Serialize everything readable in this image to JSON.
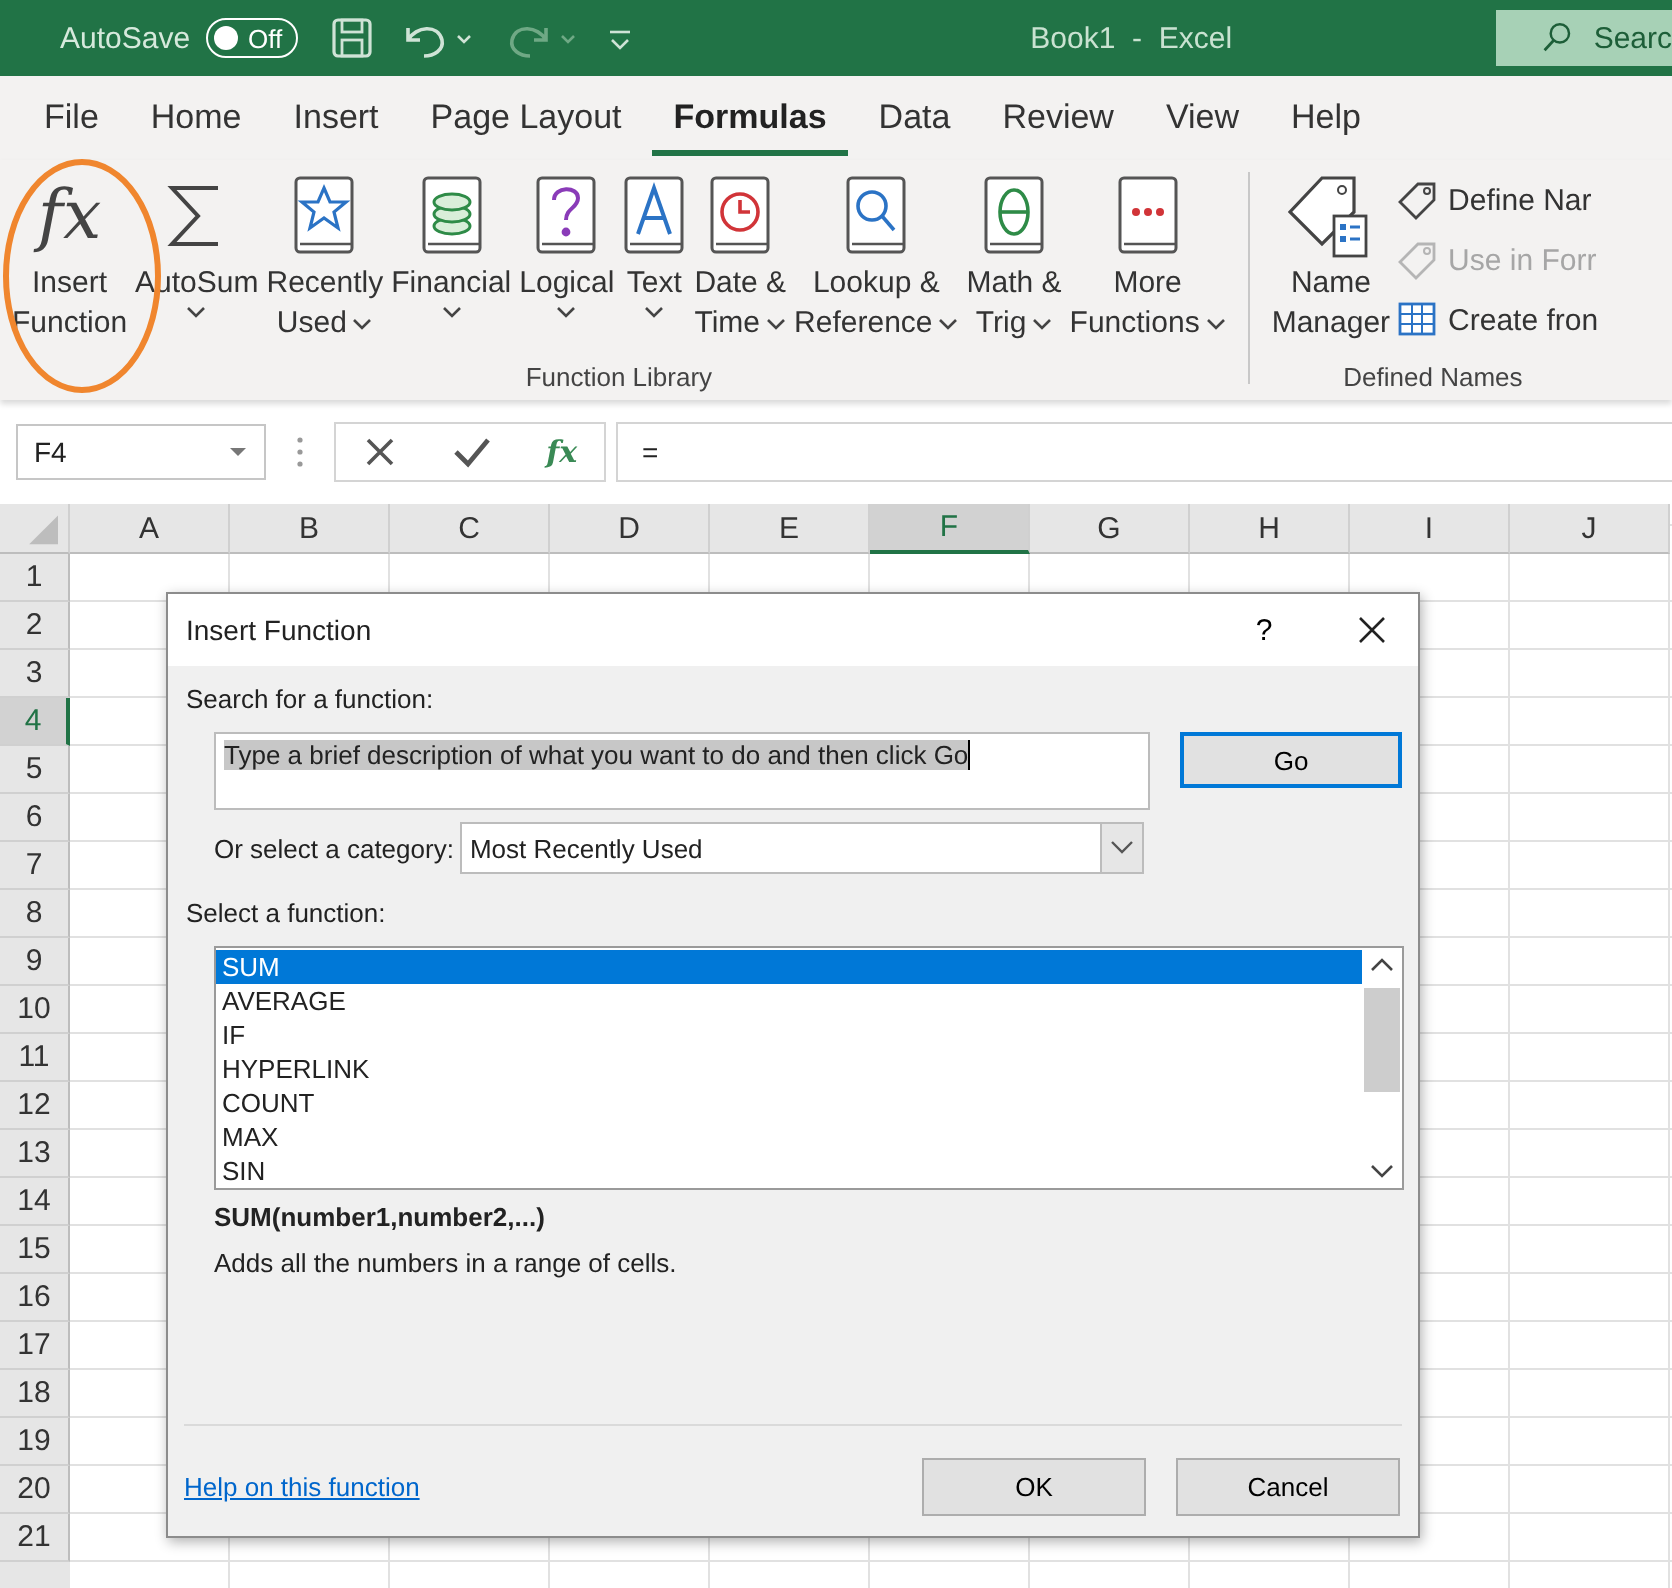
{
  "title_bar": {
    "autosave_label": "AutoSave",
    "autosave": {
      "label": "Off",
      "on": false
    },
    "document_title": "Book1  -  Excel",
    "search": {
      "placeholder": "Searc"
    }
  },
  "ribbon_tabs": [
    {
      "label": "File",
      "selected": false
    },
    {
      "label": "Home",
      "selected": false
    },
    {
      "label": "Insert",
      "selected": false
    },
    {
      "label": "Page Layout",
      "selected": false
    },
    {
      "label": "Formulas",
      "selected": true
    },
    {
      "label": "Data",
      "selected": false
    },
    {
      "label": "Review",
      "selected": false
    },
    {
      "label": "View",
      "selected": false
    },
    {
      "label": "Help",
      "selected": false
    }
  ],
  "ribbon_groups": [
    {
      "label": "Function Library",
      "large_buttons": [
        {
          "kind": "fx",
          "glyph": "fx",
          "lines": [
            "Insert",
            "Function"
          ],
          "dropdown": false,
          "highlighted": true
        },
        {
          "kind": "sum",
          "lines": [
            "AutoSum"
          ],
          "dropdown": true,
          "highlighted": false
        },
        {
          "kind": "star",
          "lines": [
            "Recently",
            "Used"
          ],
          "dropdown": true,
          "highlighted": false
        },
        {
          "kind": "coins",
          "lines": [
            "Financial"
          ],
          "dropdown": true,
          "highlighted": false
        },
        {
          "kind": "question",
          "lines": [
            "Logical"
          ],
          "dropdown": true,
          "highlighted": false
        },
        {
          "kind": "letter",
          "lines": [
            "Text"
          ],
          "dropdown": true,
          "highlighted": false
        },
        {
          "kind": "clock",
          "lines": [
            "Date &",
            "Time"
          ],
          "dropdown": true,
          "highlighted": false
        },
        {
          "kind": "magnifier",
          "lines": [
            "Lookup &",
            "Reference"
          ],
          "dropdown": true,
          "highlighted": false
        },
        {
          "kind": "theta",
          "lines": [
            "Math &",
            "Trig"
          ],
          "dropdown": true,
          "highlighted": false
        },
        {
          "kind": "dots",
          "lines": [
            "More",
            "Functions"
          ],
          "dropdown": true,
          "highlighted": false
        }
      ]
    },
    {
      "label": "Defined Names",
      "large_buttons": [
        {
          "kind": "name-tag",
          "lines": [
            "Name",
            "Manager"
          ],
          "dropdown": false,
          "highlighted": false
        }
      ],
      "small_buttons": [
        {
          "kind": "tag",
          "label": "Define Nar",
          "disabled": false
        },
        {
          "kind": "tag",
          "label": "Use in Forr",
          "disabled": true
        },
        {
          "kind": "table",
          "label": "Create fron",
          "disabled": false
        }
      ]
    }
  ],
  "formula_bar": {
    "name_box": "F4",
    "fx_glyph": "fx",
    "formula": "="
  },
  "sheet": {
    "columns": [
      {
        "label": "A",
        "selected": false
      },
      {
        "label": "B",
        "selected": false
      },
      {
        "label": "C",
        "selected": false
      },
      {
        "label": "D",
        "selected": false
      },
      {
        "label": "E",
        "selected": false
      },
      {
        "label": "F",
        "selected": true
      },
      {
        "label": "G",
        "selected": false
      },
      {
        "label": "H",
        "selected": false
      },
      {
        "label": "I",
        "selected": false
      },
      {
        "label": "J",
        "selected": false
      }
    ],
    "rows": [
      {
        "label": "1",
        "selected": false
      },
      {
        "label": "2",
        "selected": false
      },
      {
        "label": "3",
        "selected": false
      },
      {
        "label": "4",
        "selected": true
      },
      {
        "label": "5",
        "selected": false
      },
      {
        "label": "6",
        "selected": false
      },
      {
        "label": "7",
        "selected": false
      },
      {
        "label": "8",
        "selected": false
      },
      {
        "label": "9",
        "selected": false
      },
      {
        "label": "10",
        "selected": false
      },
      {
        "label": "11",
        "selected": false
      },
      {
        "label": "12",
        "selected": false
      },
      {
        "label": "13",
        "selected": false
      },
      {
        "label": "14",
        "selected": false
      },
      {
        "label": "15",
        "selected": false
      },
      {
        "label": "16",
        "selected": false
      },
      {
        "label": "17",
        "selected": false
      },
      {
        "label": "18",
        "selected": false
      },
      {
        "label": "19",
        "selected": false
      },
      {
        "label": "20",
        "selected": false
      },
      {
        "label": "21",
        "selected": false
      }
    ]
  },
  "dialog": {
    "title": "Insert Function",
    "help": "?",
    "search_label": "Search for a function:",
    "search_value": "Type a brief description of what you want to do and then click Go",
    "search_text_selected": true,
    "go_button": "Go",
    "category_label": "Or select a category:",
    "category": "Most Recently Used",
    "function_label": "Select a function:",
    "functions": [
      {
        "label": "SUM",
        "selected": true
      },
      {
        "label": "AVERAGE",
        "selected": false
      },
      {
        "label": "IF",
        "selected": false
      },
      {
        "label": "HYPERLINK",
        "selected": false
      },
      {
        "label": "COUNT",
        "selected": false
      },
      {
        "label": "MAX",
        "selected": false
      },
      {
        "label": "SIN",
        "selected": false
      }
    ],
    "signature": "SUM(number1,number2,...)",
    "description": "Adds all the numbers in a range of cells.",
    "help_link": "Help on this function",
    "buttons": [
      "OK",
      "Cancel"
    ]
  }
}
